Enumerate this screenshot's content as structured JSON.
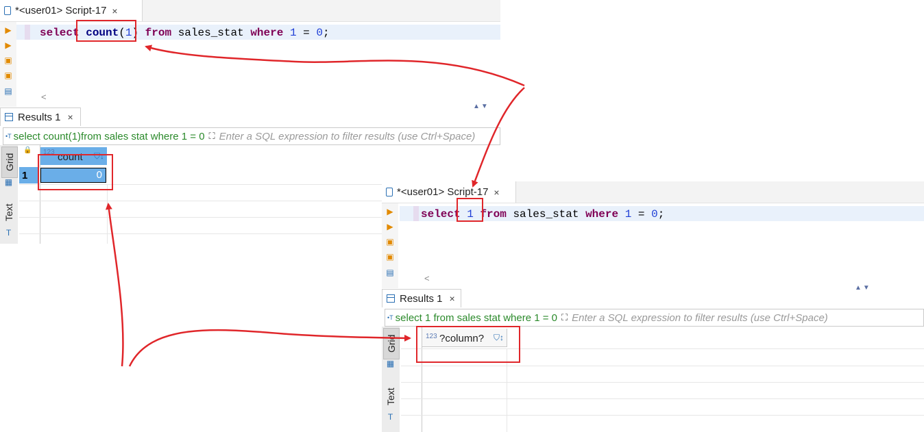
{
  "top_window": {
    "tab_title": "*<user01> Script-17",
    "tab_close": "×",
    "sql": {
      "kw_select": "select",
      "fn_count": "count",
      "paren_open": "(",
      "arg": "1",
      "paren_close": ")",
      "kw_from": "from",
      "table": "sales_stat",
      "kw_where": "where",
      "cond_left": "1",
      "op": "=",
      "cond_right": "0",
      "end": ";"
    },
    "hscroll_arrow": "<",
    "results_tab": "Results 1",
    "results_close": "×",
    "filter_query": "select count(1)from sales  stat where 1 = 0",
    "filter_placeholder": "Enter a SQL expression to filter results (use Ctrl+Space)",
    "side_tabs": [
      "Grid",
      "Text"
    ],
    "column": {
      "type_tag": "123",
      "name": "count"
    },
    "rows": [
      {
        "num": "1",
        "value": "0"
      }
    ]
  },
  "bottom_window": {
    "tab_title": "*<user01> Script-17",
    "tab_close": "×",
    "sql": {
      "kw_select": "select",
      "arg": "1",
      "kw_from": "from",
      "table": "sales_stat",
      "kw_where": "where",
      "cond_left": "1",
      "op": "=",
      "cond_right": "0",
      "end": ";"
    },
    "hscroll_arrow": "<",
    "results_tab": "Results 1",
    "results_close": "×",
    "filter_query": "select 1 from sales  stat where 1 = 0",
    "filter_placeholder": "Enter a SQL expression to filter results (use Ctrl+Space)",
    "side_tabs": [
      "Grid",
      "Text"
    ],
    "column": {
      "type_tag": "123",
      "name": "?column?"
    }
  },
  "colors": {
    "annotation": "#e0262a",
    "keyword": "#7f0055",
    "selected_cell": "#6aaee8"
  }
}
